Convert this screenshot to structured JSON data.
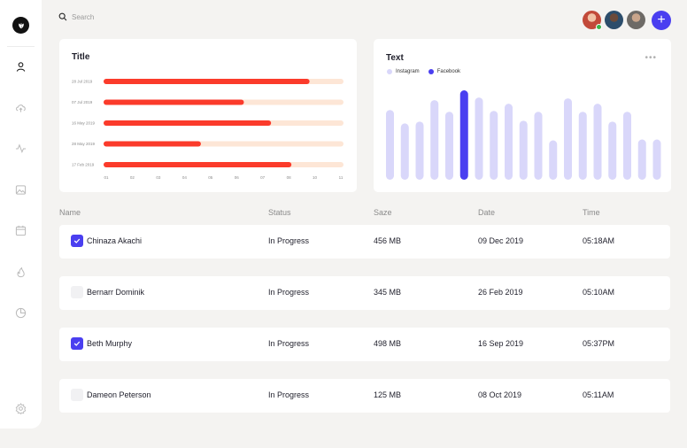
{
  "search": {
    "placeholder": "Search"
  },
  "colors": {
    "accent": "#4a3ff0",
    "bar_red": "#fb3b2b",
    "bar_track": "#fde6d6",
    "bar_light": "#d9d7fa"
  },
  "sidebar": {
    "items": [
      {
        "icon": "user-icon"
      },
      {
        "icon": "cloud-upload-icon"
      },
      {
        "icon": "activity-icon"
      },
      {
        "icon": "image-icon"
      },
      {
        "icon": "calendar-icon"
      },
      {
        "icon": "fire-icon"
      },
      {
        "icon": "pie-chart-icon"
      },
      {
        "icon": "settings-icon"
      }
    ]
  },
  "header": {
    "add_label": "+"
  },
  "chart_data": [
    {
      "type": "bar",
      "orientation": "horizontal",
      "title": "Title",
      "categories": [
        "28 Jul 2019",
        "07 Jul 2019",
        "16 May 2019",
        "28 May 2019",
        "17 Feb 2019"
      ],
      "values": [
        9.1,
        6.2,
        7.4,
        4.3,
        8.3
      ],
      "track_max": 10.6,
      "x_ticks": [
        "01",
        "02",
        "03",
        "04",
        "05",
        "06",
        "07",
        "08",
        "10",
        "11"
      ],
      "xlim": [
        0,
        10.6
      ]
    },
    {
      "type": "bar",
      "title": "Text",
      "legend": [
        "Instagram",
        "Facebook"
      ],
      "series": [
        {
          "name": "Instagram",
          "values": [
            78,
            63,
            65,
            89,
            76,
            0,
            92,
            77,
            85,
            66,
            76,
            44,
            91,
            76,
            85,
            65,
            76,
            45,
            45
          ]
        },
        {
          "name": "Facebook",
          "values": [
            0,
            0,
            0,
            0,
            0,
            100,
            0,
            0,
            0,
            0,
            0,
            0,
            0,
            0,
            0,
            0,
            0,
            0,
            0
          ]
        }
      ],
      "ylim": [
        0,
        100
      ],
      "grid": false,
      "legend_position": "top-left"
    }
  ],
  "table": {
    "headers": [
      "Name",
      "Status",
      "Saze",
      "Date",
      "Time"
    ],
    "rows": [
      {
        "checked": true,
        "name": "Chinaza Akachi",
        "status": "In Progress",
        "size": "456 MB",
        "date": "09 Dec 2019",
        "time": "05:18AM"
      },
      {
        "checked": false,
        "name": "Bernarr Dominik",
        "status": "In Progress",
        "size": "345 MB",
        "date": "26 Feb 2019",
        "time": "05:10AM"
      },
      {
        "checked": true,
        "name": "Beth Murphy",
        "status": "In Progress",
        "size": "498 MB",
        "date": "16 Sep 2019",
        "time": "05:37PM"
      },
      {
        "checked": false,
        "name": "Dameon Peterson",
        "status": "In Progress",
        "size": "125 MB",
        "date": "08 Oct 2019",
        "time": "05:11AM"
      }
    ]
  }
}
